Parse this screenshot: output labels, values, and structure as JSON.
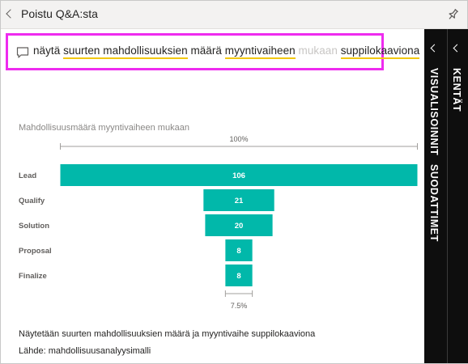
{
  "header": {
    "back_label": "Poistu Q&A:sta"
  },
  "qa": {
    "words": [
      {
        "text": "näytä",
        "style": "plain"
      },
      {
        "text": "suurten mahdollisuuksien",
        "style": "underline"
      },
      {
        "text": "määrä",
        "style": "plain"
      },
      {
        "text": "myyntivaiheen",
        "style": "underline"
      },
      {
        "text": "mukaan",
        "style": "muted"
      },
      {
        "text": "suppilokaaviona",
        "style": "underline"
      }
    ],
    "highlight_color": "#ee2bef",
    "underline_color": "#f2c811"
  },
  "chart_data": {
    "type": "funnel",
    "title": "Mahdollisuusmäärä myyntivaiheen mukaan",
    "categories": [
      "Lead",
      "Qualify",
      "Solution",
      "Proposal",
      "Finalize"
    ],
    "values": [
      106,
      21,
      20,
      8,
      8
    ],
    "top_label": "100%",
    "bottom_label": "7.5%",
    "bar_color": "#01b8aa"
  },
  "footer": {
    "description": "Näytetään suurten mahdollisuuksien määrä ja myyntivaihe suppilokaaviona",
    "source": "Lähde: mahdollisuusanalyysimalli"
  },
  "panes": {
    "visualizations_label": "VISUALISOINNIT",
    "filters_label": "SUODATTIMET",
    "fields_label": "KENTÄT"
  }
}
